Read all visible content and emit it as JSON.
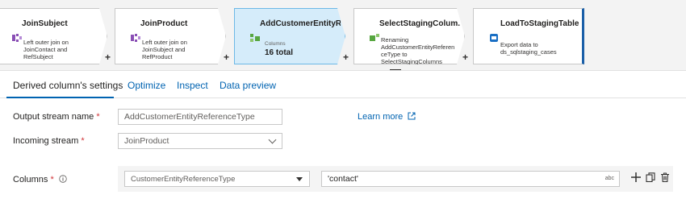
{
  "flow": {
    "nodes": [
      {
        "title": "JoinSubject",
        "desc": "Left outer join on\nJoinContact and\nRefSubject",
        "icon": "join-icon",
        "plus": "+"
      },
      {
        "title": "JoinProduct",
        "desc": "Left outer join on\nJoinSubject and\nRefProduct",
        "icon": "join-icon",
        "plus": "+"
      },
      {
        "title": "AddCustomerEntityR...",
        "columns_label": "Columns",
        "columns_value": "16 total",
        "icon": "derived-column-icon",
        "plus": "+"
      },
      {
        "title": "SelectStagingColum...",
        "desc": "Renaming\nAddCustomerEntityReferen\nceType to\nSelectStagingColumns",
        "icon": "select-icon",
        "plus": "+"
      },
      {
        "title": "LoadToStagingTable",
        "desc": "Export data to\nds_sqlstaging_cases",
        "icon": "sink-icon"
      }
    ]
  },
  "tabs": [
    {
      "label": "Derived column's settings",
      "active": true
    },
    {
      "label": "Optimize"
    },
    {
      "label": "Inspect"
    },
    {
      "label": "Data preview"
    }
  ],
  "form": {
    "output_stream": {
      "label": "Output stream name",
      "required": "*",
      "value": "AddCustomerEntityReferenceType"
    },
    "incoming_stream": {
      "label": "Incoming stream",
      "required": "*",
      "value": "JoinProduct"
    },
    "learn_more": "Learn more",
    "columns": {
      "label": "Columns",
      "required": "*",
      "column_name": "CustomerEntityReferenceType",
      "expression": "'contact'",
      "expression_type": "abc"
    }
  },
  "colors": {
    "accent": "#0063b1",
    "selected_node": "#d5ecfa",
    "required": "#d13438",
    "sink_bar": "#1a5fa8"
  }
}
